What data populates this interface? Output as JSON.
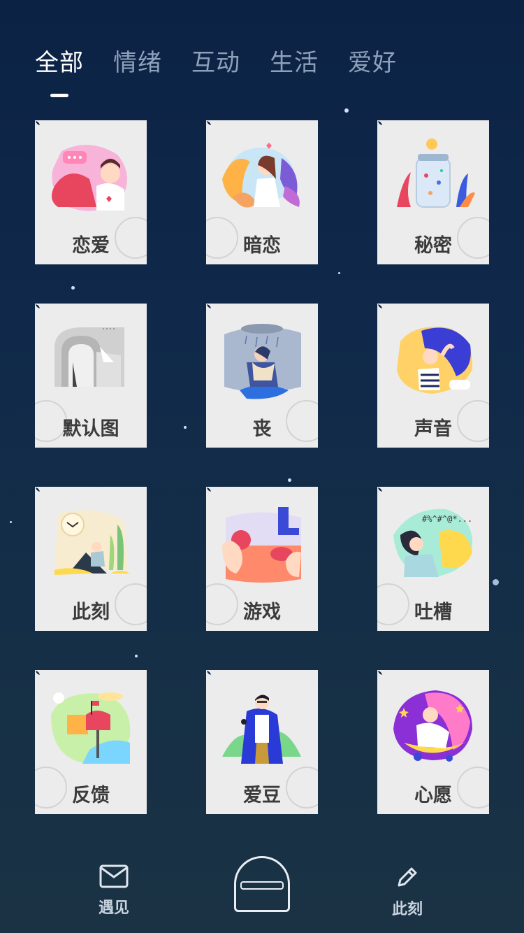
{
  "tabs": [
    {
      "label": "全部",
      "active": true
    },
    {
      "label": "情绪",
      "active": false
    },
    {
      "label": "互动",
      "active": false
    },
    {
      "label": "生活",
      "active": false
    },
    {
      "label": "爱好",
      "active": false
    }
  ],
  "stamps": [
    {
      "label": "恋爱",
      "icon": "love-couple-icon"
    },
    {
      "label": "暗恋",
      "icon": "crush-girl-icon"
    },
    {
      "label": "秘密",
      "icon": "secret-jar-icon"
    },
    {
      "label": "默认图",
      "icon": "default-mailbox-icon"
    },
    {
      "label": "丧",
      "icon": "sad-rain-icon"
    },
    {
      "label": "声音",
      "icon": "voice-girl-icon"
    },
    {
      "label": "此刻",
      "icon": "moment-clock-icon"
    },
    {
      "label": "游戏",
      "icon": "game-hands-icon"
    },
    {
      "label": "吐槽",
      "icon": "complain-icon"
    },
    {
      "label": "反馈",
      "icon": "feedback-mailbox-icon"
    },
    {
      "label": "爱豆",
      "icon": "idol-singer-icon"
    },
    {
      "label": "心愿",
      "icon": "wish-moon-icon"
    }
  ],
  "complain_text": "#%^#^@*...",
  "bottom_nav": {
    "left_label": "遇见",
    "right_label": "此刻"
  },
  "colors": {
    "background_top": "#0b2245",
    "background_bottom": "#1a3243",
    "stamp": "#ececec",
    "active_tab": "#ffffff",
    "inactive_tab": "#8ea1ba"
  }
}
